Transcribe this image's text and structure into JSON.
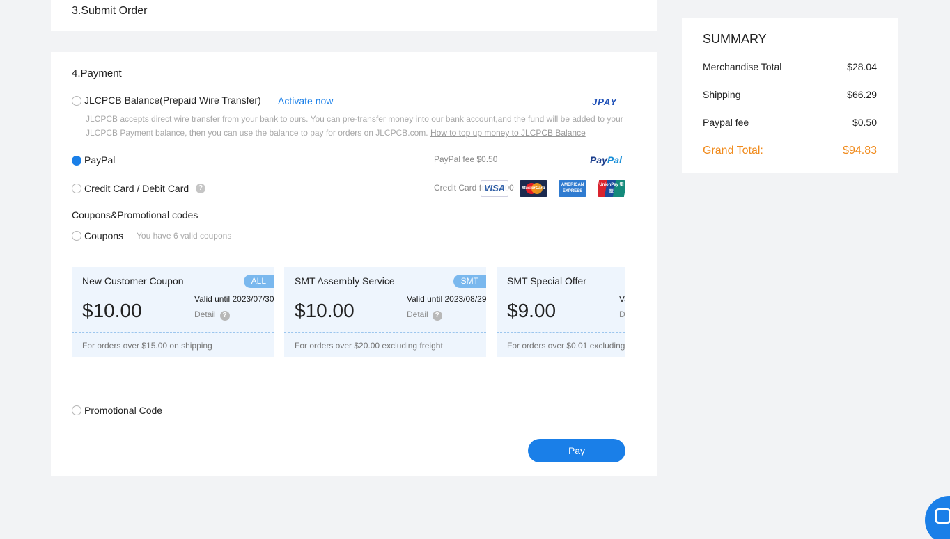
{
  "submit": {
    "title": "3.Submit Order"
  },
  "payment": {
    "title": "4.Payment",
    "balance": {
      "label": "JLCPCB Balance(Prepaid Wire Transfer)",
      "activate": "Activate now",
      "logo": "JPAY",
      "description": "JLCPCB accepts direct wire transfer from your bank to ours. You can pre-transfer money into our bank account,and the fund will be added to your JLCPCB Payment balance, then you can use the balance to pay for orders on JLCPCB.com.",
      "topup_link": "How to top up money to JLCPCB Balance"
    },
    "paypal": {
      "label": "PayPal",
      "fee": "PayPal fee $0.50",
      "logo_a": "Pay",
      "logo_b": "Pal",
      "selected": true
    },
    "card": {
      "label": "Credit Card / Debit Card",
      "fee": "Credit Card fee $0.00",
      "logos": [
        "VISA",
        "MasterCard",
        "AMERICAN EXPRESS",
        "UnionPay 银联"
      ]
    },
    "coupons_section": "Coupons&Promotional codes",
    "coupons": {
      "label": "Coupons",
      "hint": "You have 6 valid coupons",
      "items": [
        {
          "name": "New Customer Coupon",
          "tag": "ALL",
          "amount": "$10.00",
          "valid": "Valid until 2023/07/30",
          "detail": "Detail",
          "condition": "For orders over $15.00 on shipping"
        },
        {
          "name": "SMT Assembly Service",
          "tag": "SMT",
          "amount": "$10.00",
          "valid": "Valid until 2023/08/29",
          "detail": "Detail",
          "condition": "For orders over $20.00 excluding freight"
        },
        {
          "name": "SMT Special Offer",
          "tag": "",
          "amount": "$9.00",
          "valid": "Va",
          "detail": "De",
          "condition": "For orders over $0.01 excluding"
        }
      ]
    },
    "promo": {
      "label": "Promotional Code"
    },
    "pay_button": "Pay"
  },
  "summary": {
    "title": "SUMMARY",
    "rows": [
      {
        "label": "Merchandise Total",
        "value": "$28.04"
      },
      {
        "label": "Shipping",
        "value": "$66.29"
      },
      {
        "label": "Paypal fee",
        "value": "$0.50"
      }
    ],
    "grand_total": {
      "label": "Grand Total:",
      "value": "$94.83"
    }
  },
  "colors": {
    "accent": "#1a7fe8",
    "total": "#f08a1b"
  },
  "icons": {
    "help": "question-mark-icon",
    "chat": "chat-icon"
  }
}
